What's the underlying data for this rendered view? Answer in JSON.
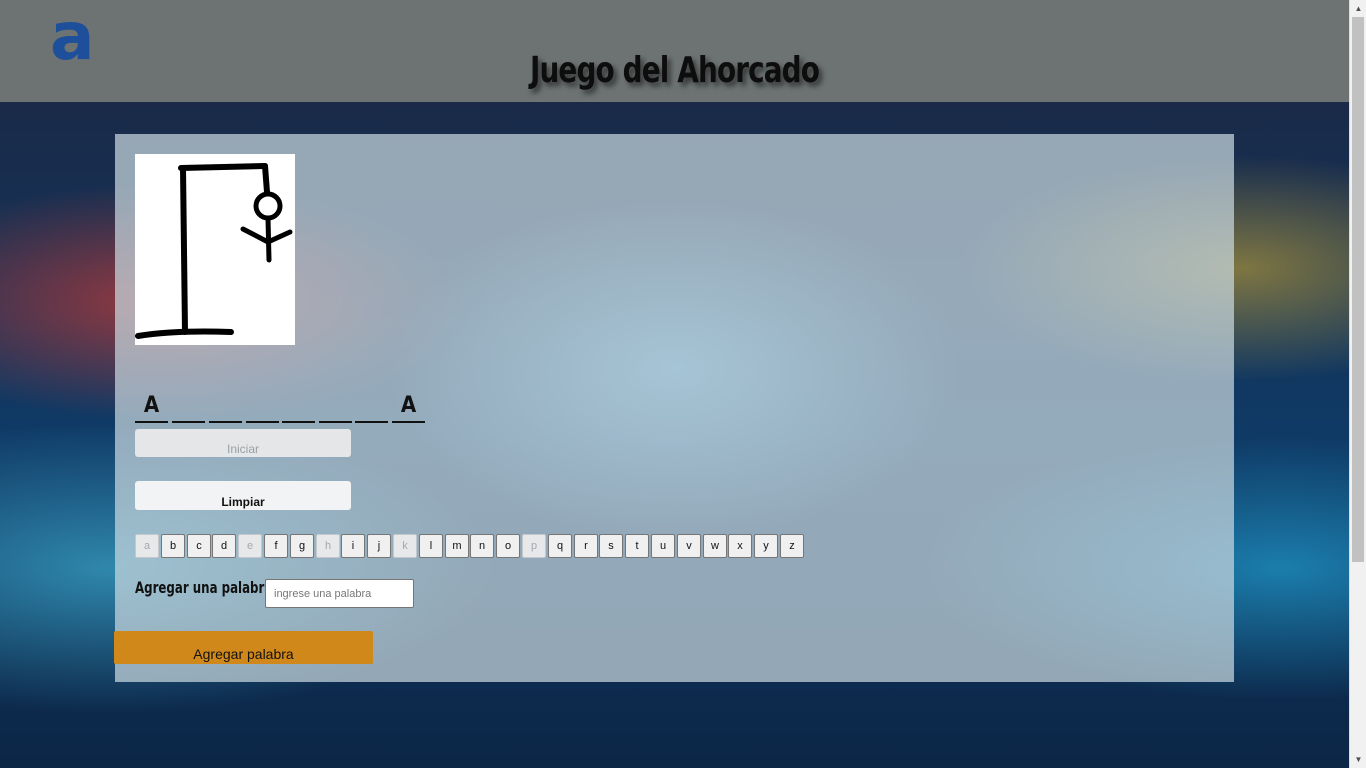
{
  "header": {
    "logo_glyph": "a",
    "title": "Juego del Ahorcado"
  },
  "game": {
    "word_slots": [
      "A",
      "",
      "",
      "",
      "",
      "",
      "",
      "A"
    ],
    "start_button": "Iniciar",
    "clear_button": "Limpiar"
  },
  "keyboard": {
    "keys": [
      {
        "letter": "a",
        "disabled": true
      },
      {
        "letter": "b",
        "disabled": false
      },
      {
        "letter": "c",
        "disabled": false
      },
      {
        "letter": "d",
        "disabled": false
      },
      {
        "letter": "e",
        "disabled": true
      },
      {
        "letter": "f",
        "disabled": false
      },
      {
        "letter": "g",
        "disabled": false
      },
      {
        "letter": "h",
        "disabled": true
      },
      {
        "letter": "i",
        "disabled": false
      },
      {
        "letter": "j",
        "disabled": false
      },
      {
        "letter": "k",
        "disabled": true
      },
      {
        "letter": "l",
        "disabled": false
      },
      {
        "letter": "m",
        "disabled": false
      },
      {
        "letter": "n",
        "disabled": false
      },
      {
        "letter": "o",
        "disabled": false
      },
      {
        "letter": "p",
        "disabled": true
      },
      {
        "letter": "q",
        "disabled": false
      },
      {
        "letter": "r",
        "disabled": false
      },
      {
        "letter": "s",
        "disabled": false
      },
      {
        "letter": "t",
        "disabled": false
      },
      {
        "letter": "u",
        "disabled": false
      },
      {
        "letter": "v",
        "disabled": false
      },
      {
        "letter": "w",
        "disabled": false
      },
      {
        "letter": "x",
        "disabled": false
      },
      {
        "letter": "y",
        "disabled": false
      },
      {
        "letter": "z",
        "disabled": false
      }
    ]
  },
  "add_word": {
    "label": "Agregar una palabra:",
    "placeholder": "ingrese una palabra",
    "value": "",
    "button": "Agregar palabra"
  },
  "colors": {
    "header_bg": "#6d7373",
    "logo": "#1d4f9a",
    "add_button": "#d1881b"
  }
}
